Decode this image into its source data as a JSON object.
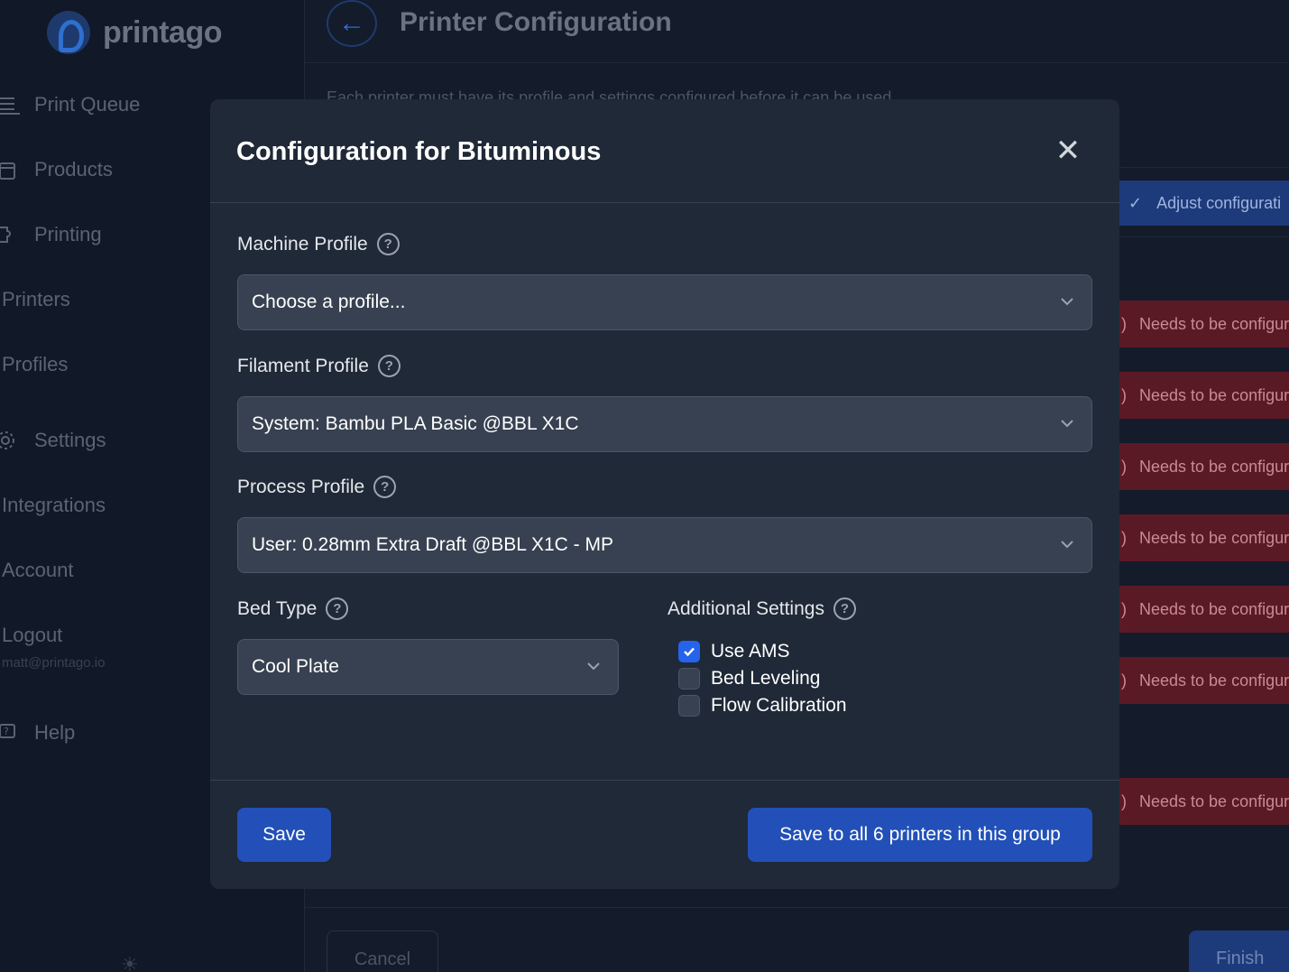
{
  "brand": {
    "name": "printago"
  },
  "sidebar": {
    "items": [
      {
        "label": "Print Queue",
        "icon": "list-icon"
      },
      {
        "label": "Products",
        "icon": "box-icon"
      },
      {
        "label": "Printing",
        "icon": "puzzle-icon"
      },
      {
        "label": "Printers"
      },
      {
        "label": "Profiles"
      },
      {
        "label": "Settings",
        "icon": "gear-icon"
      },
      {
        "label": "Integrations"
      },
      {
        "label": "Account"
      },
      {
        "label": "Logout"
      },
      {
        "label": "Help",
        "icon": "help-chat-icon"
      }
    ],
    "email": "matt@printago.io"
  },
  "page": {
    "title": "Printer Configuration",
    "intro": "Each printer must have its profile and settings configured before it can be used",
    "adjust_badge": "Adjust configurati",
    "needs_badge": "Needs to be configur",
    "cancel_label": "Cancel",
    "finish_label": "Finish"
  },
  "modal": {
    "title": "Configuration for Bituminous",
    "machine_profile": {
      "label": "Machine Profile",
      "value": "Choose a profile..."
    },
    "filament_profile": {
      "label": "Filament Profile",
      "value": "System: Bambu PLA Basic @BBL X1C"
    },
    "process_profile": {
      "label": "Process Profile",
      "value": "User: 0.28mm Extra Draft @BBL X1C - MP"
    },
    "bed_type": {
      "label": "Bed Type",
      "value": "Cool Plate"
    },
    "additional_settings": {
      "label": "Additional Settings",
      "use_ams": {
        "label": "Use AMS",
        "checked": true
      },
      "bed_leveling": {
        "label": "Bed Leveling",
        "checked": false
      },
      "flow_calibration": {
        "label": "Flow Calibration",
        "checked": false
      }
    },
    "save_label": "Save",
    "save_group_label": "Save to all 6 printers in this group"
  },
  "colors": {
    "background": "#141b2b",
    "modal": "#1f2937",
    "input": "#374151",
    "primary": "#2250b8",
    "danger_badge": "#5a1a25"
  }
}
